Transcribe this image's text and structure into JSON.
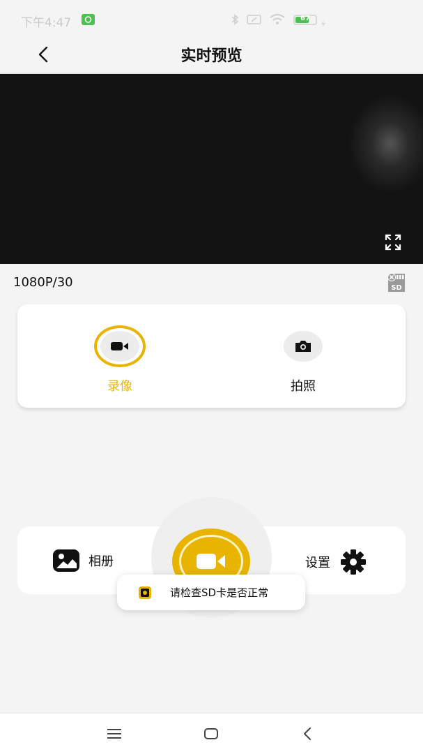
{
  "status_bar": {
    "time": "下午4:47",
    "battery_level": "67",
    "battery_fraction": 0.67
  },
  "header": {
    "title": "实时预览",
    "back_icon": "chevron-left-icon"
  },
  "preview": {
    "fullscreen_icon": "expand-icon"
  },
  "resolution": "1080P/30",
  "sd_status_icon": "sd-card-error-icon",
  "modes": {
    "record_label": "录像",
    "photo_label": "拍照",
    "selected": "record"
  },
  "controls": {
    "album_label": "相册",
    "settings_label": "设置"
  },
  "toast": {
    "message": "请检查SD卡是否正常"
  },
  "colors": {
    "accent": "#e8b400",
    "background": "#f4f4f4",
    "card": "#ffffff"
  }
}
